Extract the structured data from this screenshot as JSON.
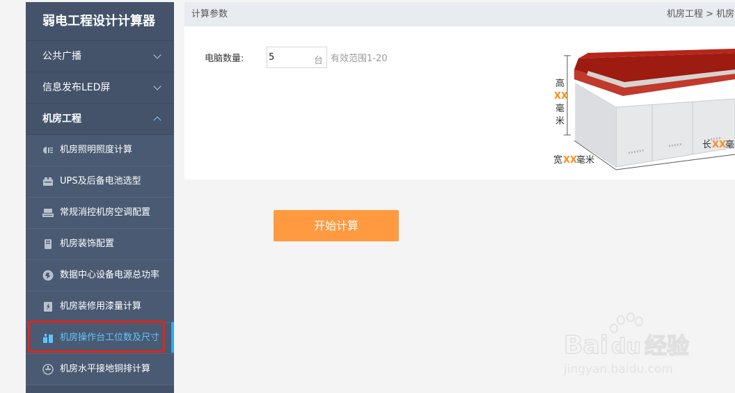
{
  "sidebar": {
    "title": "弱电工程设计计算器",
    "groups": [
      {
        "label": "公共广播"
      },
      {
        "label": "信息发布LED屏"
      },
      {
        "label": "机房工程"
      }
    ],
    "items": [
      {
        "label": "机房照明照度计算",
        "icon": "lighting-icon"
      },
      {
        "label": "UPS及后备电池选型",
        "icon": "ups-battery-icon"
      },
      {
        "label": "常规消控机房空调配置",
        "icon": "air-conditioner-icon"
      },
      {
        "label": "机房装饰配置",
        "icon": "decoration-icon"
      },
      {
        "label": "数据中心设备电源总功率",
        "icon": "power-icon"
      },
      {
        "label": "机房装修用漆量计算",
        "icon": "paint-icon"
      },
      {
        "label": "机房操作台工位数及尺寸",
        "icon": "console-desk-icon"
      },
      {
        "label": "机房水平接地铜排计算",
        "icon": "ground-bar-icon"
      }
    ]
  },
  "header": {
    "section": "计算参数",
    "breadcrumb": "机房工程 > 机房"
  },
  "form": {
    "label": "电脑数量:",
    "value": "5",
    "unit": "台",
    "range": "有效范围1-20"
  },
  "figure": {
    "height_label": [
      "高",
      "XX",
      "毫",
      "米"
    ],
    "width_prefix": "宽",
    "width_mark": "XX",
    "width_suffix": "毫米",
    "length_prefix": "长",
    "length_mark": "XX",
    "length_suffix": "毫"
  },
  "action": {
    "start_label": "开始计算"
  },
  "watermark": {
    "brand_a": "Bai",
    "brand_b": "du",
    "brand_c": "经验",
    "url": "jingyan.baidu.com"
  },
  "colors": {
    "sidebar_bg": "#44536a",
    "accent_orange": "#ff9a40",
    "highlight_red": "#e0251a",
    "active_blue": "#5cc6ff",
    "mark_orange": "#ff8c1a"
  }
}
